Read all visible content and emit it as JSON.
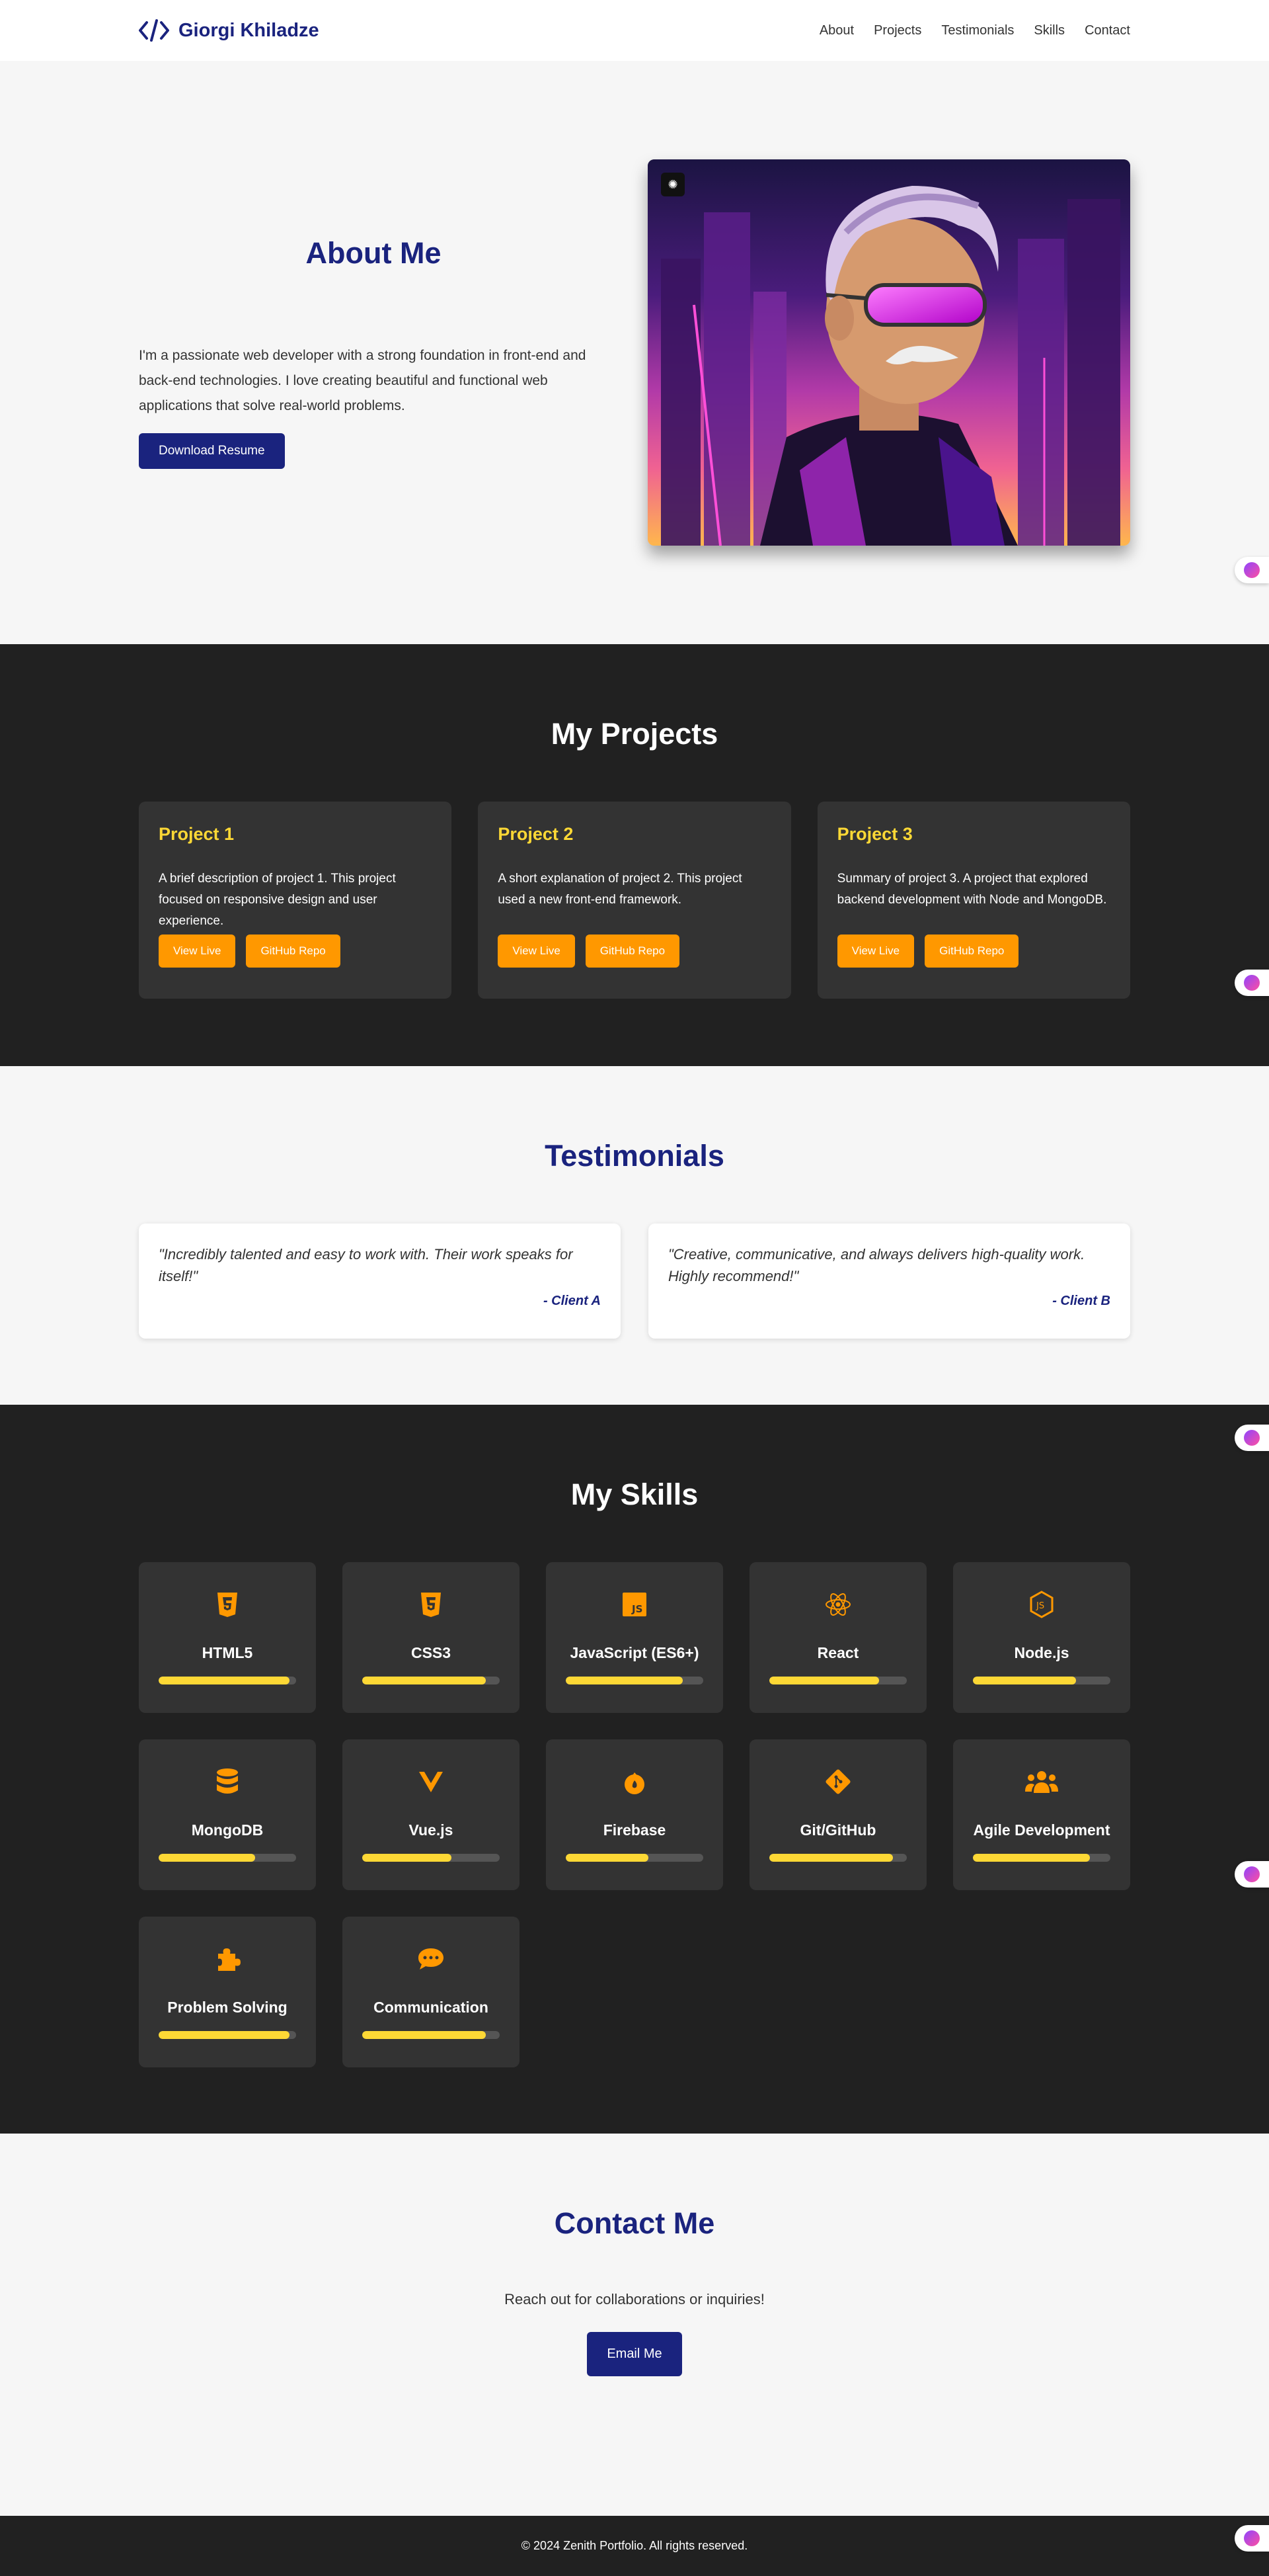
{
  "header": {
    "logo_text": "Giorgi Khiladze",
    "nav": [
      "About",
      "Projects",
      "Testimonials",
      "Skills",
      "Contact"
    ]
  },
  "about": {
    "title": "About Me",
    "text": "I'm a passionate web developer with a strong foundation in front-end and back-end technologies. I love creating beautiful and functional web applications that solve real-world problems.",
    "button": "Download Resume",
    "image_icon": "brain-icon"
  },
  "projects": {
    "title": "My Projects",
    "items": [
      {
        "title": "Project 1",
        "desc": "A brief description of project 1. This project focused on responsive design and user experience.",
        "live": "View Live",
        "repo": "GitHub Repo"
      },
      {
        "title": "Project 2",
        "desc": "A short explanation of project 2. This project used a new front-end framework.",
        "live": "View Live",
        "repo": "GitHub Repo"
      },
      {
        "title": "Project 3",
        "desc": "Summary of project 3. A project that explored backend development with Node and MongoDB.",
        "live": "View Live",
        "repo": "GitHub Repo"
      }
    ]
  },
  "testimonials": {
    "title": "Testimonials",
    "items": [
      {
        "quote": "\"Incredibly talented and easy to work with. Their work speaks for itself!\"",
        "author": "- Client A"
      },
      {
        "quote": "\"Creative, communicative, and always delivers high-quality work. Highly recommend!\"",
        "author": "- Client B"
      }
    ]
  },
  "skills": {
    "title": "My Skills",
    "items": [
      {
        "name": "HTML5",
        "icon": "html5-icon",
        "level": 0.95
      },
      {
        "name": "CSS3",
        "icon": "css3-icon",
        "level": 0.9
      },
      {
        "name": "JavaScript (ES6+)",
        "icon": "javascript-icon",
        "level": 0.85
      },
      {
        "name": "React",
        "icon": "react-icon",
        "level": 0.8
      },
      {
        "name": "Node.js",
        "icon": "nodejs-icon",
        "level": 0.75
      },
      {
        "name": "MongoDB",
        "icon": "database-icon",
        "level": 0.7
      },
      {
        "name": "Vue.js",
        "icon": "vuejs-icon",
        "level": 0.65
      },
      {
        "name": "Firebase",
        "icon": "fire-icon",
        "level": 0.6
      },
      {
        "name": "Git/GitHub",
        "icon": "git-icon",
        "level": 0.9
      },
      {
        "name": "Agile Development",
        "icon": "team-icon",
        "level": 0.85
      },
      {
        "name": "Problem Solving",
        "icon": "puzzle-icon",
        "level": 0.95
      },
      {
        "name": "Communication",
        "icon": "chat-icon",
        "level": 0.9
      }
    ]
  },
  "contact": {
    "title": "Contact Me",
    "subtitle": "Reach out for collaborations or inquiries!",
    "button": "Email Me"
  },
  "footer": {
    "text": "© 2024 Zenith Portfolio. All rights reserved."
  },
  "colors": {
    "primary": "#1a237e",
    "accent": "#ff9800",
    "highlight": "#fdd835",
    "dark": "#212121"
  }
}
